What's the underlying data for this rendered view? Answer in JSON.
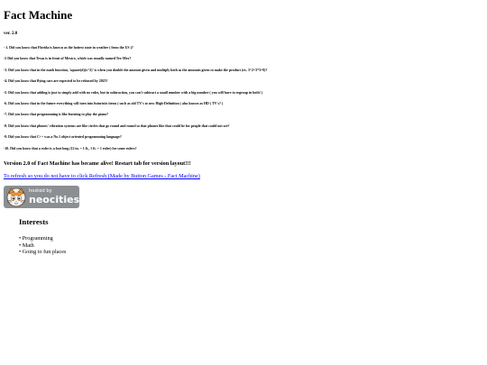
{
  "page": {
    "title": "Fact Machine",
    "version": "ver. 2.0"
  },
  "facts": [
    "- 1. Did you know that Florida is known as the hottest state in weather ( from the US )?",
    "-2 Did you know that Texas is in front of Mexico, which was usually named Tex-Mex?",
    "-3. Did you know that in the math function, 'square(d)(x^2)' is when you double the amount given and multiply both as the amounts given to make the product (ex. 3^2=3*3=9)?",
    "-4. Did you know that flying cars are expected to be released by 2025?",
    "-5. Did you know that adding is just to simply add with no rules, but in subtraction, you can't subtract a small number with a big number ( you will have to regroup in both! )",
    "-6. Did you know that in the future everything will turn into futuristic items ( such as old TV's to new High-Definition ( also known as HD ) TV's? )",
    "-7. Did you know that programming is like learning to play the piano?",
    "-8. Did you know that phones' vibration systems are like circles that go round and round so that phones like that could be for people that could not see?",
    "-9. Did you know that C++ was a No.1 object oriented programming language?",
    "-10. Did you know that a ruler is a foot long (12 in. = 1 ft., 1 ft. = 1 ruler) for some rulers?"
  ],
  "announcement": "Version 2.0 of Fact Machine has became alive! Restart tab for version layout!!!",
  "refresh_link": "To refresh so you do not have to click Refresh (Made by Button Games - Fact Machine)",
  "badge": {
    "hosted_text": "hosted by",
    "brand_text": "neocities"
  },
  "interests": {
    "heading": "Interests",
    "items": [
      "Programming",
      "Math",
      "Going to fun places"
    ]
  },
  "colors": {
    "link": "#0000ee",
    "badge_bg": "#8c8f92",
    "cat_orange": "#f08c2a"
  }
}
